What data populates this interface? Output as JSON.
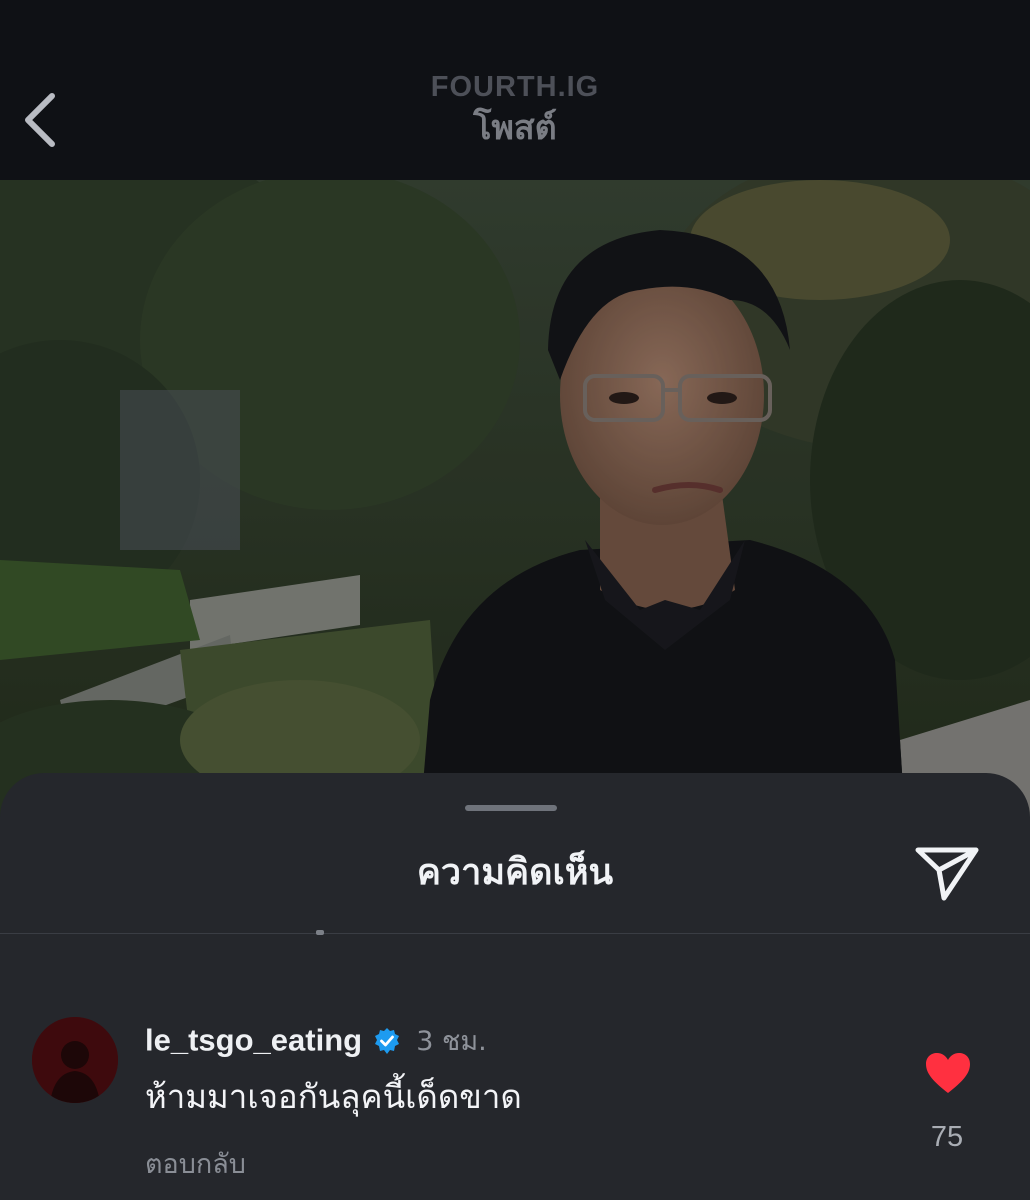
{
  "header": {
    "username": "FOURTH.IG",
    "page_label": "โพสต์",
    "back_icon": "chevron-left-icon"
  },
  "post": {
    "image": "photo of person with glasses in black polo in front of trees"
  },
  "comments_sheet": {
    "title": "ความคิดเห็น",
    "share_icon": "paper-plane-icon",
    "comment": {
      "username": "le_tsgo_eating",
      "verified": true,
      "time": "3 ชม.",
      "text": "ห้ามมาเจอกันลุคนี้เด็ดขาด",
      "reply_label": "ตอบกลับ",
      "like_count": "75",
      "liked": true,
      "like_color": "#ff3040",
      "verified_color": "#1d9bf0"
    }
  }
}
